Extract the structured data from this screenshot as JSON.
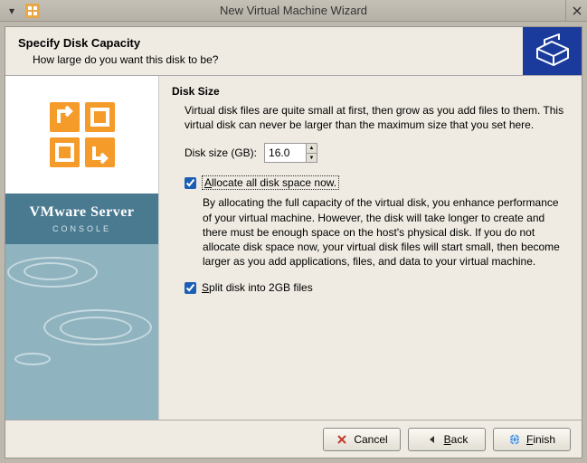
{
  "window": {
    "title": "New Virtual Machine Wizard"
  },
  "header": {
    "title": "Specify Disk Capacity",
    "subtitle": "How large do you want this disk to be?"
  },
  "sidebar": {
    "brand_title": "VMware Server",
    "brand_sub": "CONSOLE"
  },
  "main": {
    "section_title": "Disk Size",
    "intro": "Virtual disk files are quite small at first, then grow as you add files to them. This virtual disk can never be larger than the maximum size that you set here.",
    "size_label": "Disk size (GB):",
    "size_value": "16.0",
    "allocate": {
      "checked": true,
      "label_pre": "A",
      "label_post": "llocate all disk space now.",
      "desc": "By allocating the full capacity of the virtual disk, you enhance performance of your virtual machine. However, the disk will take longer to create and there must be enough space on the host's physical disk. If you do not allocate disk space now, your virtual disk files will start small, then become larger as you add applications, files, and data to your virtual machine."
    },
    "split": {
      "checked": true,
      "label_pre": "S",
      "label_post": "plit disk into 2GB files"
    }
  },
  "footer": {
    "cancel": "Cancel",
    "back_u": "B",
    "back_rest": "ack",
    "finish_u": "F",
    "finish_rest": "inish"
  }
}
